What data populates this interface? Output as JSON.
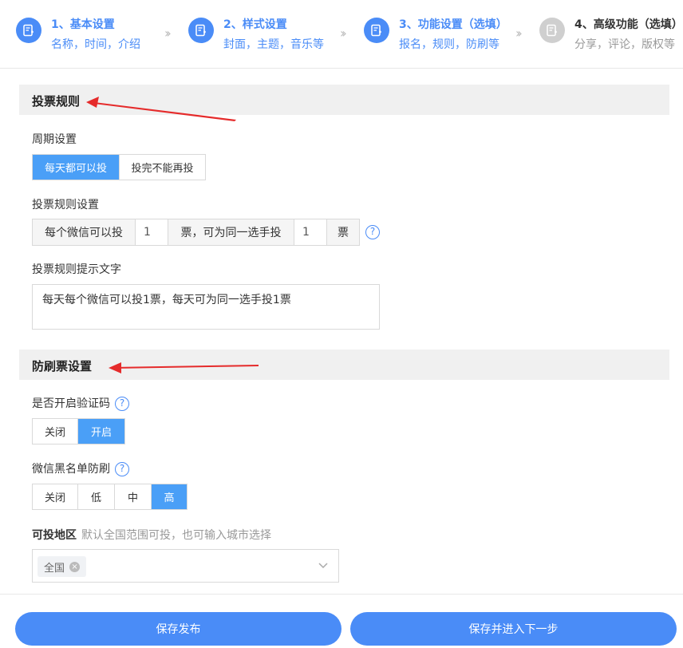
{
  "steps": [
    {
      "title": "1、基本设置",
      "sub": "名称，时间，介绍",
      "state": "done"
    },
    {
      "title": "2、样式设置",
      "sub": "封面，主题，音乐等",
      "state": "done"
    },
    {
      "title": "3、功能设置（选填）",
      "sub": "报名，规则，防刷等",
      "state": "current"
    },
    {
      "title": "4、高级功能（选填）",
      "sub": "分享，评论，版权等",
      "state": "pending"
    }
  ],
  "vote_rules": {
    "header": "投票规则",
    "period_label": "周期设置",
    "period_options": [
      "每天都可以投",
      "投完不能再投"
    ],
    "period_selected": "每天都可以投",
    "rule_label": "投票规则设置",
    "rule_prefix": "每个微信可以投",
    "votes_per_wechat": "1",
    "rule_middle": "票，可为同一选手投",
    "votes_per_candidate": "1",
    "rule_suffix": "票",
    "help_glyph": "?",
    "tip_label": "投票规则提示文字",
    "tip_text": "每天每个微信可以投1票，每天可为同一选手投1票"
  },
  "anti_fraud": {
    "header": "防刷票设置",
    "captcha_label": "是否开启验证码",
    "captcha_options": [
      "关闭",
      "开启"
    ],
    "captcha_selected": "开启",
    "blacklist_label": "微信黑名单防刷",
    "blacklist_options": [
      "关闭",
      "低",
      "中",
      "高"
    ],
    "blacklist_selected": "高",
    "region_label": "可投地区",
    "region_hint": "默认全国范围可投，也可输入城市选择",
    "region_tag": "全国",
    "region_tag_remove": "×"
  },
  "footer": {
    "publish_label": "保存发布",
    "next_label": "保存并进入下一步"
  },
  "colors": {
    "accent": "#4a8cf7",
    "active_seg": "#4a9ff7",
    "annotation_arrow": "#e52b2b"
  }
}
